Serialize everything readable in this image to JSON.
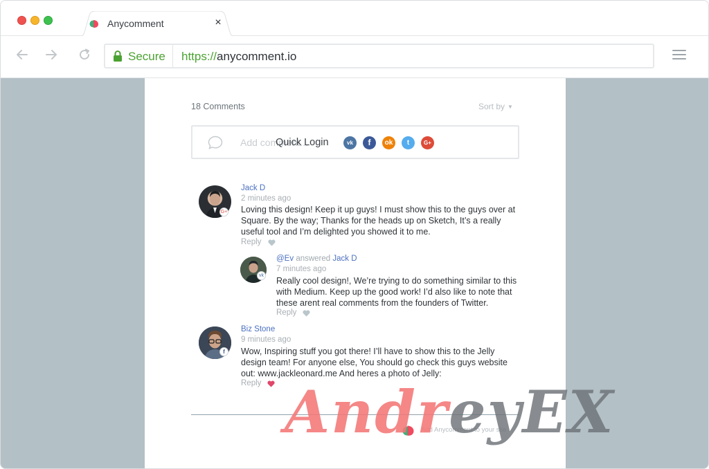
{
  "browser": {
    "tab_title": "Anycomment",
    "secure_label": "Secure",
    "url_scheme": "https://",
    "url_host": "anycomment.io"
  },
  "widget": {
    "comment_count": "18 Comments",
    "sort_label": "Sort by",
    "compose_placeholder": "Add comment...",
    "quick_login_label": "Quick Login",
    "social_providers": [
      "vk",
      "facebook",
      "odnoklassniki",
      "twitter",
      "google-plus"
    ],
    "reply_label": "Reply",
    "footer_text": "Add Anycomment to your site"
  },
  "comments": [
    {
      "author": "Jack D",
      "time": "2 minutes ago",
      "text": "Loving this design! Keep it up guys! I must show this to the guys over at Square. By the way; Thanks for the heads up on Sketch, It’s a really useful tool and I’m delighted you showed it to me.",
      "liked": false,
      "network_icon": "google-plus-icon"
    },
    {
      "author": "@Ev",
      "answered_label": "answered",
      "answered_to": "Jack D",
      "time": "7 minutes ago",
      "text": "Really cool design!, We’re trying to do something similar to this with Medium. Keep up the good work! I’d also like to note that these arent real comments from the founders of Twitter.",
      "liked": false,
      "network_icon": "vk-icon"
    },
    {
      "author": "Biz Stone",
      "time": "9 minutes ago",
      "text": "Wow, Inspiring stuff you got there! I’ll have to show this to the Jelly design team! For anyone else, You should go check this guys website out: www.jackleonard.me And heres a photo of Jelly:",
      "liked": true,
      "network_icon": "facebook-icon"
    }
  ],
  "watermark": {
    "part_a": "Andr",
    "part_b": "eyEX"
  },
  "colors": {
    "viewport_bg": "#b3c0c6",
    "link_blue": "#4a70c0",
    "secure_green": "#4ba232",
    "like_red": "#e0476a",
    "heart_grey": "#b9c6cb"
  }
}
